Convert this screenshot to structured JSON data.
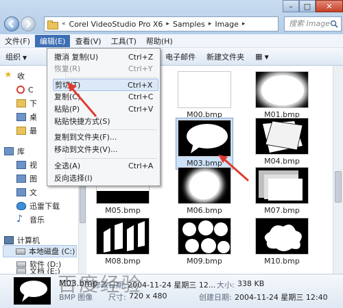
{
  "window": {
    "address": [
      "Corel VideoStudio Pro X6",
      "Samples",
      "Image"
    ],
    "address_prefix": "«",
    "search_placeholder": "搜索 Image",
    "controls": {
      "minimize": "–",
      "maximize": "□",
      "close": "✕"
    }
  },
  "menubar": [
    {
      "label": "文件(F)"
    },
    {
      "label": "编辑(E)"
    },
    {
      "label": "查看(V)"
    },
    {
      "label": "工具(T)"
    },
    {
      "label": "帮助(H)"
    }
  ],
  "toolbar": {
    "organize": "组织",
    "email": "电子邮件",
    "new_folder": "新建文件夹"
  },
  "edit_menu": [
    {
      "label": "撤消 复制(U)",
      "key": "Ctrl+Z",
      "disabled": false
    },
    {
      "label": "恢复(R)",
      "key": "Ctrl+Y",
      "disabled": true
    },
    {
      "label": "剪切(T)",
      "key": "Ctrl+X",
      "disabled": false
    },
    {
      "label": "复制(C)",
      "key": "Ctrl+C",
      "disabled": false
    },
    {
      "label": "粘贴(P)",
      "key": "Ctrl+V",
      "disabled": false
    },
    {
      "label": "粘贴快捷方式(S)",
      "key": "",
      "disabled": false
    },
    {
      "label": "复制到文件夹(F)...",
      "key": "",
      "disabled": false
    },
    {
      "label": "移动到文件夹(V)...",
      "key": "",
      "disabled": false
    },
    {
      "label": "全选(A)",
      "key": "Ctrl+A",
      "disabled": false
    },
    {
      "label": "反向选择(I)",
      "key": "",
      "disabled": false
    }
  ],
  "nav": {
    "favorites": "收",
    "fav_items": [
      "C",
      "下",
      "桌",
      "最"
    ],
    "libraries": "库",
    "lib_items": [
      "视",
      "图",
      "文",
      "迅雷下载",
      "音乐"
    ],
    "computer": "计算机",
    "drives": [
      "本地磁盘 (C:)",
      "软件 (D:)",
      "文档 (E:)"
    ]
  },
  "files": [
    {
      "name": "M00.bmp"
    },
    {
      "name": "M01.bmp"
    },
    {
      "name": "M03.bmp",
      "selected": true
    },
    {
      "name": "M04.bmp"
    },
    {
      "name": "M05.bmp"
    },
    {
      "name": "M06.bmp"
    },
    {
      "name": "M07.bmp"
    },
    {
      "name": "M08.bmp"
    },
    {
      "name": "M09.bmp"
    },
    {
      "name": "M10.bmp"
    }
  ],
  "details": {
    "name": "M03.bmp",
    "modified_label": "修改日期:",
    "modified": "2004-11-24 星期三 12...",
    "size_label": "大小:",
    "size": "338 KB",
    "type": "BMP 图像",
    "dims_label": "尺寸:",
    "dims": "720 x 480",
    "created_label": "创建日期:",
    "created": "2004-11-24 星期三 12:40"
  },
  "watermark": "百度经验"
}
